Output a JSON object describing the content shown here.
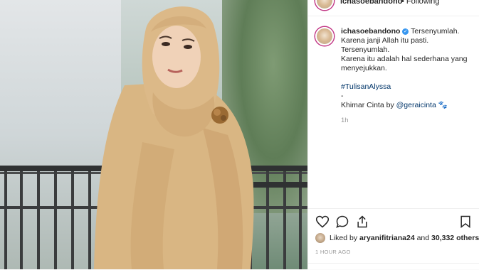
{
  "post": {
    "username": "ichasoebandono",
    "follow_text": "• Following",
    "caption_lines": [
      "Tersenyumlah.",
      "Karena janji Allah itu pasti.",
      "Tersenyumlah.",
      "Karena itu adalah hal sederhana yang menyejukkan."
    ],
    "hashtag": "#TulisanAlyssa",
    "dash": "-",
    "credit_prefix": "Khimar Cinta by ",
    "credit_handle": "@geraicinta",
    "credit_emoji": "🐾",
    "time": "1h"
  },
  "likes": {
    "liked_by_prefix": "Liked by ",
    "liker": "aryanifitriana24",
    "and_text": " and ",
    "others": "30,332 others"
  },
  "timestamp": "1 HOUR AGO",
  "icons": [
    "heart-icon",
    "comment-icon",
    "share-icon",
    "bookmark-icon",
    "verified-badge-icon"
  ],
  "colors": {
    "verified": "#3897f0",
    "link": "#003569",
    "muted": "#999999",
    "hijab": "#d9b683"
  }
}
